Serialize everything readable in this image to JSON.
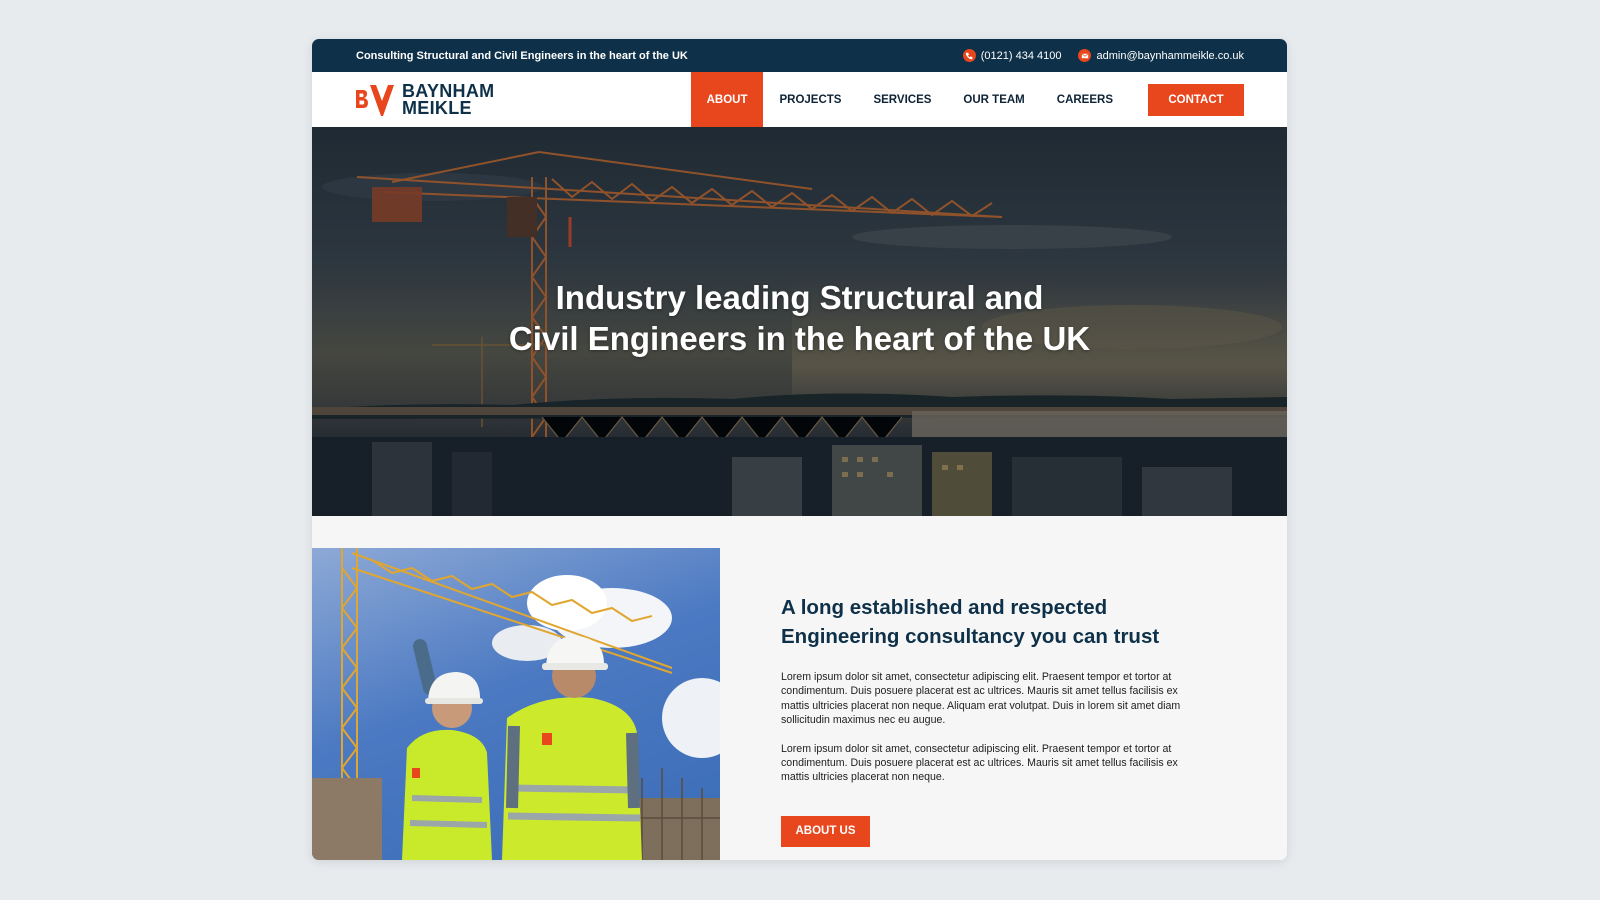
{
  "topbar": {
    "tagline": "Consulting Structural and Civil Engineers in the heart of the UK",
    "phone": "(0121) 434 4100",
    "email": "admin@baynhammeikle.co.uk"
  },
  "brand": {
    "line1": "BAYNHAM",
    "line2": "MEIKLE",
    "accent_color": "#e8461c",
    "navy_color": "#0e3149"
  },
  "nav": {
    "items": [
      {
        "label": "ABOUT",
        "active": true
      },
      {
        "label": "PROJECTS",
        "active": false
      },
      {
        "label": "SERVICES",
        "active": false
      },
      {
        "label": "OUR TEAM",
        "active": false
      },
      {
        "label": "CAREERS",
        "active": false
      }
    ],
    "contact_label": "CONTACT"
  },
  "hero": {
    "title_line1": "Industry leading Structural and",
    "title_line2": "Civil Engineers in the heart of the UK"
  },
  "about": {
    "heading_line1": "A long established and respected",
    "heading_line2": "Engineering consultancy you can trust",
    "para1": "Lorem ipsum dolor sit amet, consectetur adipiscing elit. Praesent tempor et tortor at condimentum. Duis posuere placerat est ac ultrices. Mauris sit amet tellus facilisis ex mattis ultricies placerat non neque. Aliquam erat volutpat. Duis in lorem sit amet diam sollicitudin maximus nec eu augue.",
    "para2": "Lorem ipsum dolor sit amet, consectetur adipiscing elit. Praesent tempor et tortor at condimentum. Duis posuere placerat est ac ultrices. Mauris sit amet tellus facilisis ex mattis ultricies placerat non neque.",
    "button_label": "ABOUT US"
  },
  "icons": {
    "phone": "phone-icon",
    "email": "email-icon"
  }
}
